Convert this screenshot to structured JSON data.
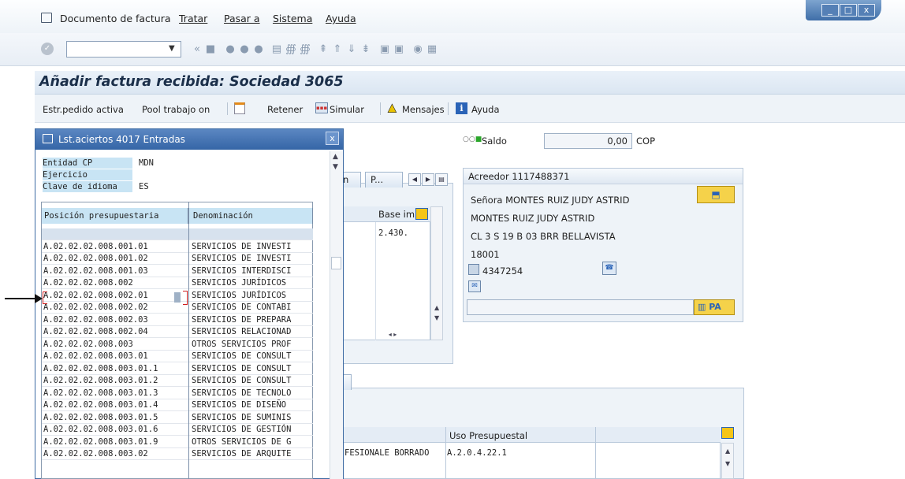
{
  "menu": {
    "items": [
      "Documento de factura",
      "Tratar",
      "Pasar a",
      "Sistema",
      "Ayuda"
    ]
  },
  "window_controls": {
    "minimize": "_",
    "maximize": "□",
    "close": "x"
  },
  "toolbar": {
    "command_value": ""
  },
  "screen": {
    "title": "Añadir factura recibida: Sociedad 3065"
  },
  "app_toolbar": {
    "estr_pedido": "Estr.pedido activa",
    "pool": "Pool trabajo on",
    "retener": "Retener",
    "simular": "Simular",
    "mensajes": "Mensajes",
    "ayuda": "Ayuda"
  },
  "saldo": {
    "label": "Saldo",
    "value": "0,00",
    "currency": "COP"
  },
  "dialog": {
    "title": "Lst.aciertos 4017 Entradas",
    "close": "x",
    "criteria": [
      {
        "label": "Entidad CP",
        "value": "MDN"
      },
      {
        "label": "Ejercicio",
        "value": ""
      },
      {
        "label": "Clave de idioma",
        "value": "ES"
      }
    ],
    "columns": [
      "Posición presupuestaria",
      "Denominación"
    ],
    "rows": [
      {
        "pos": "",
        "den": ""
      },
      {
        "pos": "A.02.02.02.008.001.01",
        "den": "SERVICIOS DE INVESTI"
      },
      {
        "pos": "A.02.02.02.008.001.02",
        "den": "SERVICIOS DE INVESTI"
      },
      {
        "pos": "A.02.02.02.008.001.03",
        "den": "SERVICIOS INTERDISCI"
      },
      {
        "pos": "A.02.02.02.008.002",
        "den": "SERVICIOS JURÍDICOS"
      },
      {
        "pos": "A.02.02.02.008.002.01",
        "den": "SERVICIOS JURÍDICOS"
      },
      {
        "pos": "A.02.02.02.008.002.02",
        "den": "SERVICIOS DE CONTABI"
      },
      {
        "pos": "A.02.02.02.008.002.03",
        "den": "SERVICIOS DE PREPARA"
      },
      {
        "pos": "A.02.02.02.008.002.04",
        "den": "SERVICIOS RELACIONAD"
      },
      {
        "pos": "A.02.02.02.008.003",
        "den": "OTROS SERVICIOS PROF"
      },
      {
        "pos": "A.02.02.02.008.003.01",
        "den": "SERVICIOS DE CONSULT"
      },
      {
        "pos": "A.02.02.02.008.003.01.1",
        "den": "SERVICIOS DE CONSULT"
      },
      {
        "pos": "A.02.02.02.008.003.01.2",
        "den": "SERVICIOS DE CONSULT"
      },
      {
        "pos": "A.02.02.02.008.003.01.3",
        "den": "SERVICIOS DE TECNOLO"
      },
      {
        "pos": "A.02.02.02.008.003.01.4",
        "den": "SERVICIOS DE DISEÑO"
      },
      {
        "pos": "A.02.02.02.008.003.01.5",
        "den": "SERVICIOS DE SUMINIS"
      },
      {
        "pos": "A.02.02.02.008.003.01.6",
        "den": "SERVICIOS DE GESTIÓN"
      },
      {
        "pos": "A.02.02.02.008.003.01.9",
        "den": "OTROS SERVICIOS DE G"
      },
      {
        "pos": "A.02.02.02.008.003.02",
        "den": "SERVICIOS DE ARQUITE"
      }
    ]
  },
  "middle_panel": {
    "tab_n": "n",
    "tab_p": "P...",
    "col_base": "Base im",
    "base_value": "2.430."
  },
  "vendor": {
    "header": "Acreedor 1117488371",
    "salutation": "Señora MONTES RUIZ JUDY ASTRID",
    "name": "MONTES RUIZ JUDY ASTRID",
    "address": "CL 3 S 19 B 03 BRR BELLAVISTA",
    "postal": "18001",
    "phone": "4347254",
    "pa_label": "PA"
  },
  "bottom": {
    "uso_header": "Uso Presupuestal",
    "row_text": "FESIONALE BORRADO",
    "uso_value": "A.2.0.4.22.1"
  }
}
